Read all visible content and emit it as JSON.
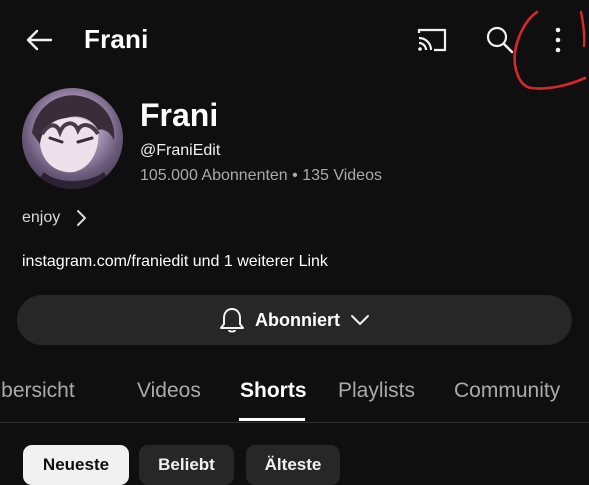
{
  "header": {
    "title": "Frani",
    "icons": [
      "arrow-back-icon",
      "cast-icon",
      "search-icon",
      "more-vert-icon"
    ]
  },
  "channel": {
    "name": "Frani",
    "handle": "@FraniEdit",
    "stats": "105.000 Abonnenten • 135 Videos",
    "description": "enjoy",
    "link_text": "instagram.com/franiedit und 1 weiterer Link"
  },
  "subscribe": {
    "label": "Abonniert"
  },
  "tabs": [
    {
      "label": "Übersicht",
      "active": false
    },
    {
      "label": "Videos",
      "active": false
    },
    {
      "label": "Shorts",
      "active": true
    },
    {
      "label": "Playlists",
      "active": false
    },
    {
      "label": "Community",
      "active": false
    }
  ],
  "filters": [
    {
      "label": "Neueste",
      "selected": true
    },
    {
      "label": "Beliebt",
      "selected": false
    },
    {
      "label": "Älteste",
      "selected": false
    }
  ],
  "colors": {
    "background": "#0f0f0f",
    "surface": "#272727",
    "text_primary": "#f1f1f1",
    "text_secondary": "#aaaaaa",
    "annotation": "#d6262e"
  }
}
